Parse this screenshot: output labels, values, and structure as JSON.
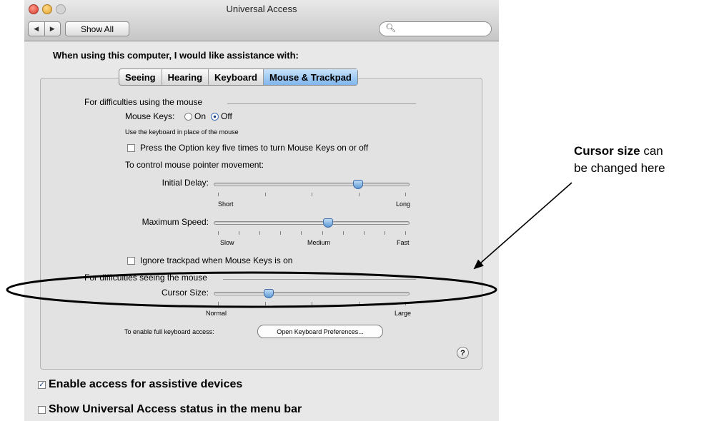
{
  "window": {
    "title": "Universal Access",
    "nav": {
      "back": "◀",
      "forward": "▶"
    },
    "show_all": "Show All",
    "search": {
      "placeholder": "",
      "value": ""
    }
  },
  "heading": "When using this computer, I would like assistance with:",
  "tabs": [
    "Seeing",
    "Hearing",
    "Keyboard",
    "Mouse & Trackpad"
  ],
  "active_tab": "Mouse & Trackpad",
  "mouse_section": {
    "title": "For difficulties using the mouse",
    "mouse_keys_label": "Mouse Keys:",
    "on_label": "On",
    "off_label": "Off",
    "selected": "Off",
    "hint": "Use the keyboard in place of the mouse",
    "option_key_label": "Press the Option key five times to turn Mouse Keys on or off",
    "option_key_checked": false,
    "pointer_caption": "To control mouse pointer movement:",
    "initial_delay": {
      "label": "Initial Delay:",
      "min_label": "Short",
      "max_label": "Long",
      "value": 0.75
    },
    "max_speed": {
      "label": "Maximum Speed:",
      "min_label": "Slow",
      "mid_label": "Medium",
      "max_label": "Fast",
      "value": 0.59
    },
    "ignore_trackpad_label": "Ignore trackpad when Mouse Keys is on",
    "ignore_trackpad_checked": false
  },
  "seeing_section": {
    "title": "For difficulties seeing the mouse",
    "cursor_size": {
      "label": "Cursor Size:",
      "min_label": "Normal",
      "max_label": "Large",
      "value": 0.27
    }
  },
  "keyboard_access": {
    "caption": "To enable full keyboard access:",
    "button": "Open Keyboard Preferences..."
  },
  "help": "?",
  "bottom": {
    "assistive_label": "Enable access for assistive devices",
    "assistive_checked": true,
    "status_menu_label": "Show Universal Access status in the menu bar",
    "status_menu_checked": false
  },
  "annotation": {
    "bold": "Cursor size",
    "rest": " can",
    "line2": "be changed here"
  },
  "colors": {
    "highlight_tab": "#8fc3f3",
    "knob": "#6aa3de",
    "check": "#1e3f80"
  }
}
